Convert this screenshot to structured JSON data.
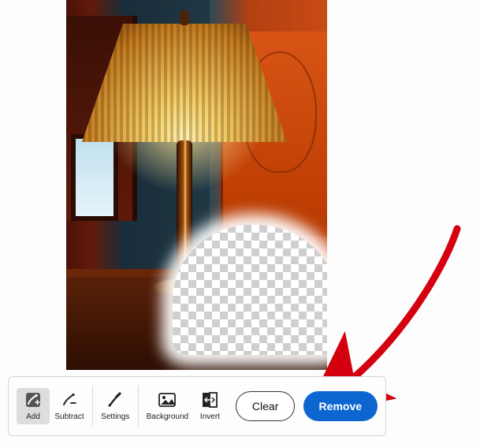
{
  "toolbar": {
    "add_label": "Add",
    "subtract_label": "Subtract",
    "settings_label": "Settings",
    "background_label": "Background",
    "invert_label": "Invert",
    "clear_label": "Clear",
    "remove_label": "Remove"
  },
  "annotation": {
    "arrow_target": "remove-button"
  },
  "colors": {
    "primary": "#0d66d0",
    "arrow": "#d4000f"
  }
}
